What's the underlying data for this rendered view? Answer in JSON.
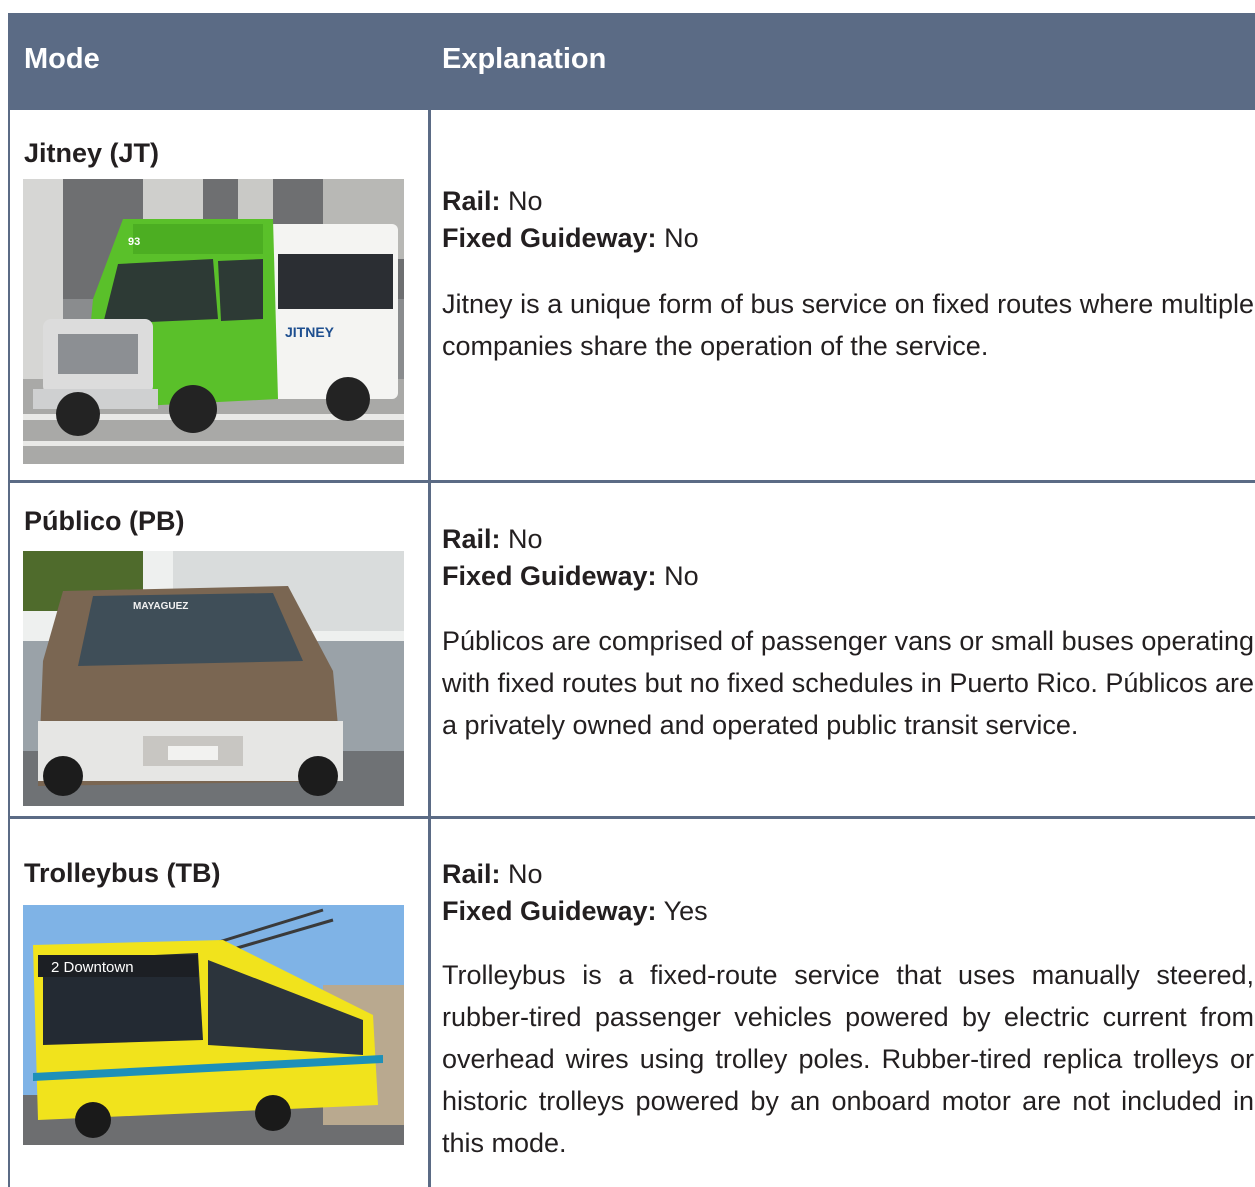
{
  "header": {
    "mode": "Mode",
    "explanation": "Explanation"
  },
  "rows": [
    {
      "mode": "Jitney (JT)",
      "rail_label": "Rail:",
      "rail_value": "No",
      "guideway_label": "Fixed Guideway:",
      "guideway_value": "No",
      "description": "Jitney is a unique form of bus service on fixed routes where multiple companies share the operation of the service.",
      "photo_text": {
        "number": "93",
        "brand": "JITNEY"
      }
    },
    {
      "mode": "Público (PB)",
      "rail_label": "Rail:",
      "rail_value": "No",
      "guideway_label": "Fixed Guideway:",
      "guideway_value": "No",
      "description": "Públicos are comprised of passenger vans or small buses operating with fixed routes but no fixed schedules in Puerto Rico. Públicos are a privately owned and operated public transit service.",
      "photo_text": {
        "windshield": "MAYAGUEZ"
      }
    },
    {
      "mode": "Trolleybus (TB)",
      "rail_label": "Rail:",
      "rail_value": "No",
      "guideway_label": "Fixed Guideway:",
      "guideway_value": "Yes",
      "description": "Trolleybus is a fixed-route service that uses manually steered, rubber-tired passenger vehicles powered by electric current from overhead wires using trolley poles. Rubber-tired replica trolleys or historic trolleys powered by an onboard motor are not included in this mode.",
      "photo_text": {
        "destination": "2  Downtown"
      }
    }
  ],
  "colors": {
    "header_bg": "#5b6b85",
    "grid": "#5b6b85",
    "text": "#231f20"
  }
}
